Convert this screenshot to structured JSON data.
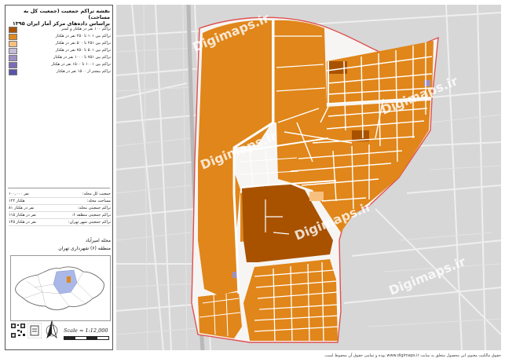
{
  "legend": {
    "title": "نقشه تراکم جمعیت (جمعیت کل به مساحت)",
    "subtitle": "براساس داده‌های مرکز آمار ایران ۱۳۹۵",
    "items": [
      {
        "label": "تراکم ۱۰۰ نفر در هکتار و کمتر",
        "color": "#a85200"
      },
      {
        "label": "تراکم بین ۱۰۱ تا ۲۵۰ نفر در هکتار",
        "color": "#e08a1c"
      },
      {
        "label": "تراکم بین ۲۵۱ تا ۵۰۰ نفر در هکتار",
        "color": "#f8c07e"
      },
      {
        "label": "تراکم بین ۵۰۱ تا ۷۵۰ نفر در هکتار",
        "color": "#c4bcd8"
      },
      {
        "label": "تراکم بین ۷۵۱ تا ۱۰۰۰ نفر در هکتار",
        "color": "#9d8fc4"
      },
      {
        "label": "تراکم بین ۱۰۰۱ تا ۱۵۰۰ نفر در هکتار",
        "color": "#7c6cb5"
      },
      {
        "label": "تراکم بیشتر از ۱۵۰۰ نفر در هکتار",
        "color": "#5a55a8"
      }
    ]
  },
  "stats": [
    {
      "key": "جمعیت کل محله:",
      "value": "۱۰۰,۰۰۰ نفر"
    },
    {
      "key": "مساحت محله:",
      "value": "۱۲۲ هکتار"
    },
    {
      "key": "تراکم جمعیتی محله:",
      "value": "۸۱ نفر در هکتار"
    },
    {
      "key": "تراکم جمعیتی منطقه ۶:",
      "value": "۱۱۵ نفر در هکتار"
    },
    {
      "key": "تراکم جمعیتی شهر تهران:",
      "value": "۱۴۵ نفر در هکتار"
    }
  ],
  "location": {
    "district_name": "محله امیرآباد",
    "municipal_area": "منطقه (۶) شهرداری تهران"
  },
  "scale_text": "Scale = 1:12,000",
  "watermark": "Digimaps.ir",
  "footer_text": "حقوق مالکیت معنوی این محصول متعلق به سایت www.digimaps.ir بوده و تمامی حقوق آن محفوظ است.",
  "colors": {
    "boundary": "#e05050",
    "background": "#d7d7d7",
    "road": "#f4f4f4",
    "inset_highlight": "#a9b8e6"
  },
  "icons": [
    "north-arrow-icon",
    "qr-code-icon",
    "digimaps-logo-icon"
  ]
}
